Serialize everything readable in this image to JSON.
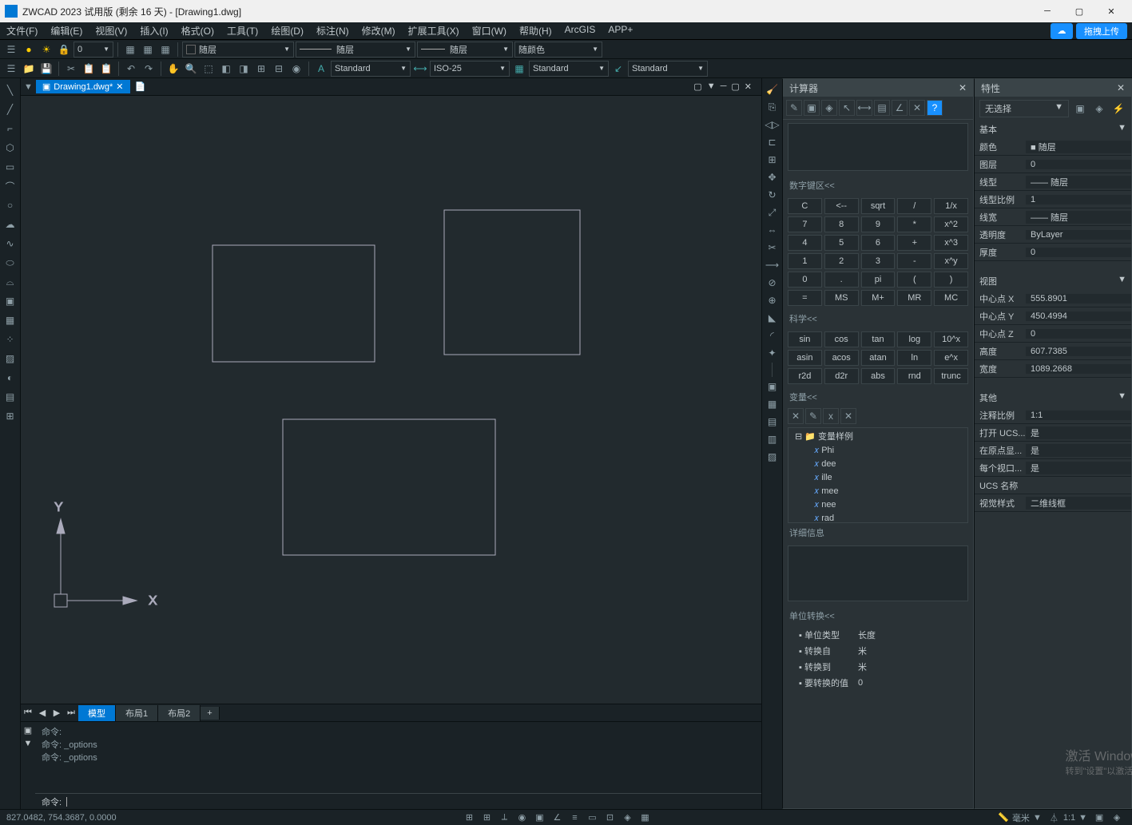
{
  "titlebar": {
    "title": "ZWCAD 2023 试用版 (剩余 16 天) - [Drawing1.dwg]"
  },
  "menubar": {
    "items": [
      "文件(F)",
      "编辑(E)",
      "视图(V)",
      "插入(I)",
      "格式(O)",
      "工具(T)",
      "绘图(D)",
      "标注(N)",
      "修改(M)",
      "扩展工具(X)",
      "窗口(W)",
      "帮助(H)",
      "ArcGIS",
      "APP+"
    ]
  },
  "cloud": {
    "upload": "拖拽上传"
  },
  "toolbar1": {
    "layer_dd": "随层",
    "lw_dd": "随层",
    "lt_dd": "随层",
    "color_dd": "随颜色",
    "zero": "0"
  },
  "toolbar2": {
    "std1": "Standard",
    "std2": "ISO-25",
    "std3": "Standard",
    "std4": "Standard"
  },
  "doc_tab": "Drawing1.dwg*",
  "model_tabs": {
    "model": "模型",
    "layout1": "布局1",
    "layout2": "布局2"
  },
  "command": {
    "history": [
      "命令:",
      "命令: _options",
      "",
      "命令: _options",
      "",
      ""
    ],
    "prompt": "命令:"
  },
  "status": {
    "coords": "827.0482, 754.3687, 0.0000",
    "mm": "毫米",
    "ratio": "1:1"
  },
  "calc": {
    "title": "计算器",
    "numpad_title": "数字键区<<",
    "numpad": [
      [
        "C",
        "<--",
        "sqrt",
        "/",
        "1/x"
      ],
      [
        "7",
        "8",
        "9",
        "*",
        "x^2"
      ],
      [
        "4",
        "5",
        "6",
        "+",
        "x^3"
      ],
      [
        "1",
        "2",
        "3",
        "-",
        "x^y"
      ],
      [
        "0",
        ".",
        "pi",
        "(",
        ")"
      ],
      [
        "=",
        "MS",
        "M+",
        "MR",
        "MC"
      ]
    ],
    "sci_title": "科学<<",
    "sci": [
      [
        "sin",
        "cos",
        "tan",
        "log",
        "10^x"
      ],
      [
        "asin",
        "acos",
        "atan",
        "ln",
        "e^x"
      ],
      [
        "r2d",
        "d2r",
        "abs",
        "rnd",
        "trunc"
      ]
    ],
    "var_title": "变量<<",
    "var_root": "变量样例",
    "vars": [
      "Phi",
      "dee",
      "ille",
      "mee",
      "nee",
      "rad"
    ],
    "detail_title": "详细信息",
    "unit_title": "单位转换<<",
    "unit_rows": [
      [
        "单位类型",
        "长度"
      ],
      [
        "转换自",
        "米"
      ],
      [
        "转换到",
        "米"
      ],
      [
        "要转换的值",
        "0"
      ]
    ]
  },
  "props": {
    "title": "特性",
    "no_sel": "无选择",
    "sections": {
      "basic": {
        "title": "基本",
        "rows": [
          [
            "颜色",
            "■ 随层"
          ],
          [
            "图层",
            "0"
          ],
          [
            "线型",
            "—— 随层"
          ],
          [
            "线型比例",
            "1"
          ],
          [
            "线宽",
            "—— 随层"
          ],
          [
            "透明度",
            "ByLayer"
          ],
          [
            "厚度",
            "0"
          ]
        ]
      },
      "view": {
        "title": "视图",
        "rows": [
          [
            "中心点 X",
            "555.8901"
          ],
          [
            "中心点 Y",
            "450.4994"
          ],
          [
            "中心点 Z",
            "0"
          ],
          [
            "高度",
            "607.7385"
          ],
          [
            "宽度",
            "1089.2668"
          ]
        ]
      },
      "other": {
        "title": "其他",
        "rows": [
          [
            "注释比例",
            "1:1"
          ],
          [
            "打开 UCS...",
            "是"
          ],
          [
            "在原点显...",
            "是"
          ],
          [
            "每个视口...",
            "是"
          ],
          [
            "UCS 名称",
            ""
          ],
          [
            "视觉样式",
            "二维线框"
          ]
        ]
      }
    }
  },
  "activate": {
    "line1": "激活 Windows",
    "line2": "转到\"设置\"以激活 Windows。"
  }
}
